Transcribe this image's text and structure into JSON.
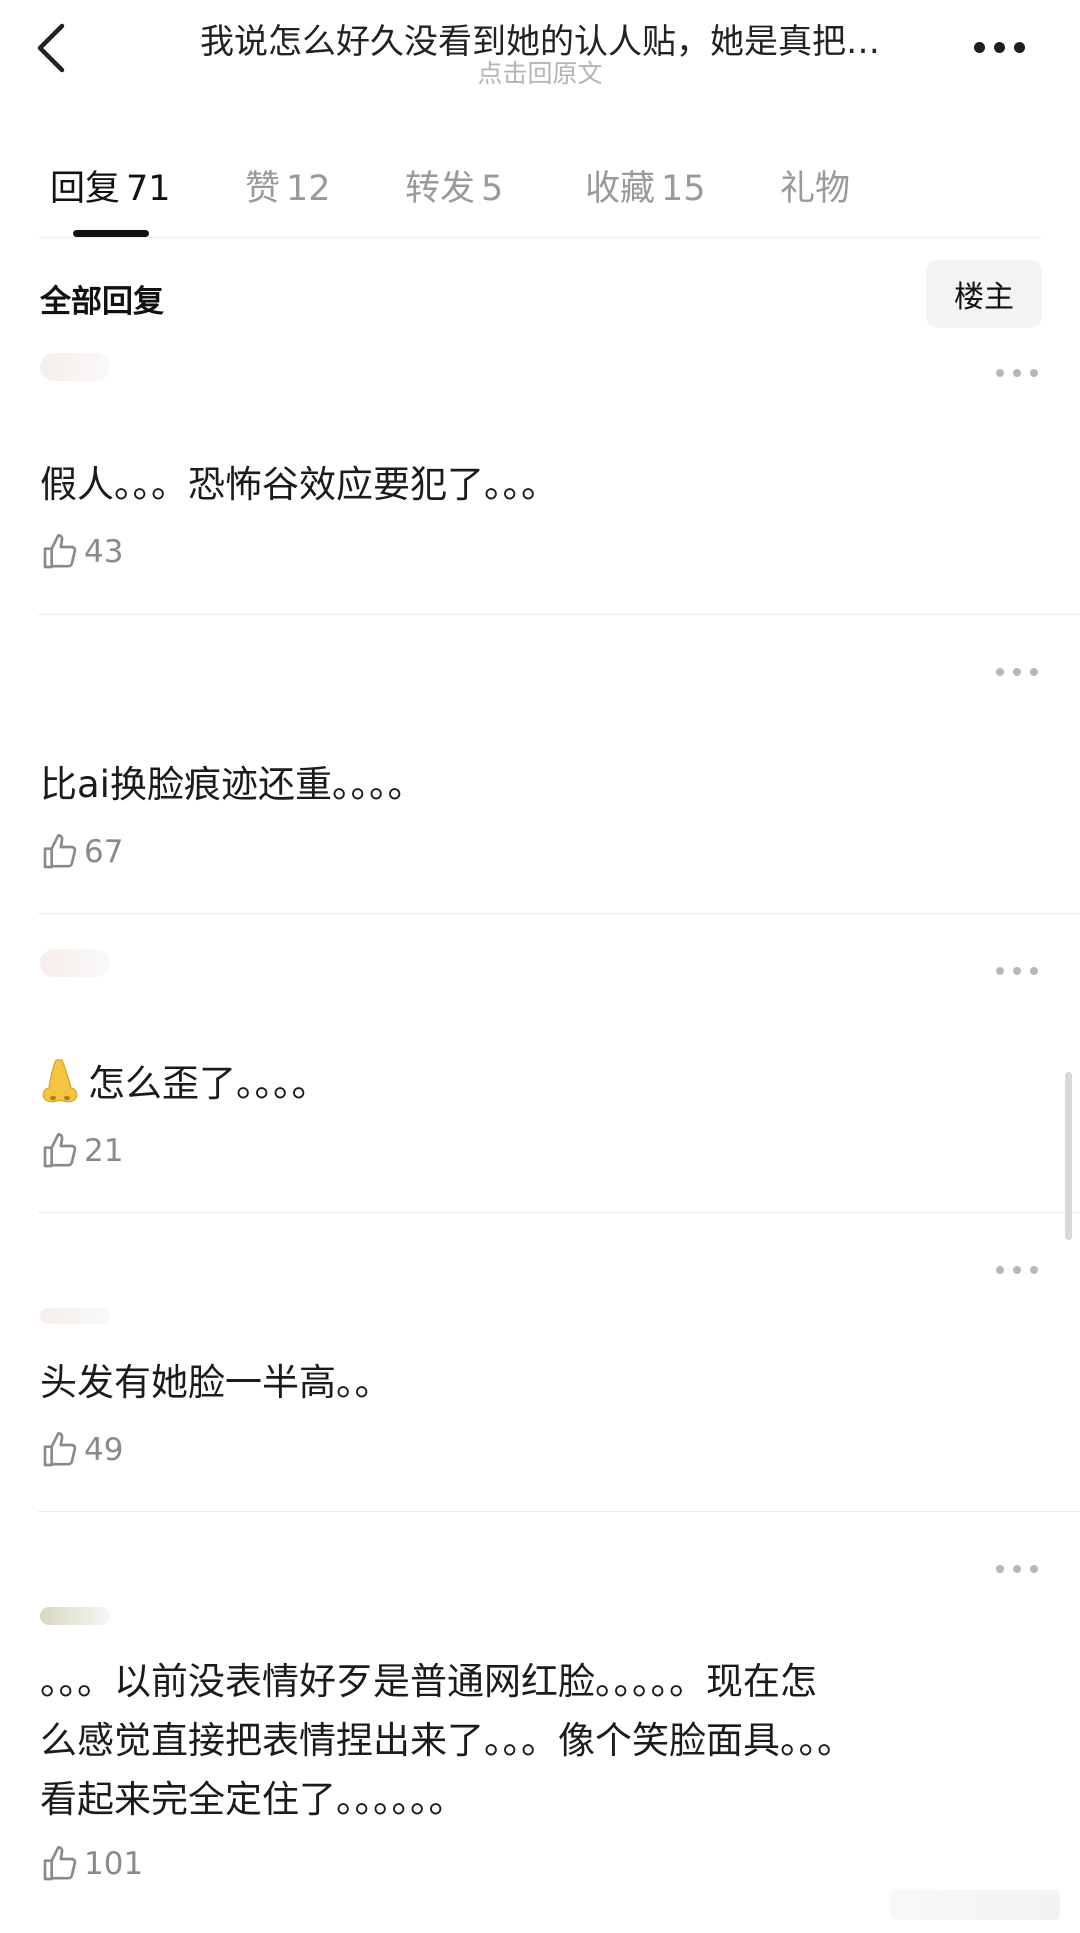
{
  "header": {
    "title": "我说怎么好久没看到她的认人贴，她是真把…",
    "subtitle": "点击回原文"
  },
  "tabs": [
    {
      "label": "回复",
      "count": "71",
      "active": true
    },
    {
      "label": "赞",
      "count": "12",
      "active": false
    },
    {
      "label": "转发",
      "count": "5",
      "active": false
    },
    {
      "label": "收藏",
      "count": "15",
      "active": false
    },
    {
      "label": "礼物",
      "count": "",
      "active": false
    }
  ],
  "filter": {
    "label": "全部回复",
    "louzhu": "楼主"
  },
  "comments": [
    {
      "text": "假人。。。恐怖谷效应要犯了。。。",
      "likes": "43"
    },
    {
      "text": "比ai换脸痕迹还重。。。。",
      "likes": "67"
    },
    {
      "emoji": "nose-emoji",
      "text": "怎么歪了。。。。",
      "likes": "21"
    },
    {
      "text": "头发有她脸一半高。。",
      "likes": "49"
    },
    {
      "lines": [
        "。。。以前没表情好歹是普通网红脸。。。。。现在怎",
        "么感觉直接把表情捏出来了。。。像个笑脸面具。。。",
        "看起来完全定住了。。。。。。"
      ],
      "likes": "101"
    }
  ],
  "icons": {
    "back": "chevron-left-icon",
    "more": "more-horizontal-icon",
    "like": "thumbs-up-icon",
    "comment_more": "more-horizontal-icon"
  },
  "colors": {
    "active_tab": "#111111",
    "inactive_tab": "#9a9a9a",
    "secondary_text": "#8a8a8a",
    "divider": "#ececec"
  }
}
